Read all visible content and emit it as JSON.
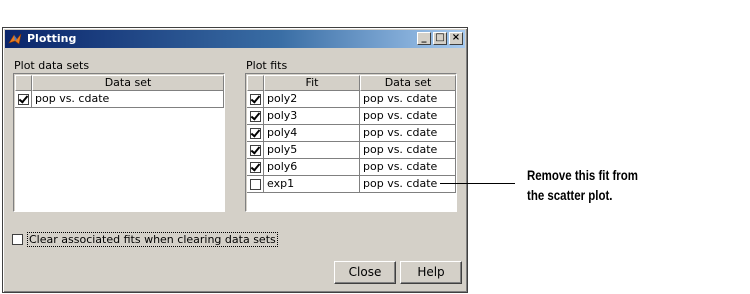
{
  "window": {
    "title": "Plotting",
    "minimize": "_",
    "maximize": "□",
    "close": "×"
  },
  "datasets": {
    "label": "Plot data sets",
    "header": "Data set",
    "rows": [
      {
        "checked": true,
        "name": "pop vs. cdate"
      }
    ]
  },
  "fits": {
    "label": "Plot fits",
    "headers": {
      "fit": "Fit",
      "dataset": "Data set"
    },
    "rows": [
      {
        "checked": true,
        "fit": "poly2",
        "dataset": "pop vs. cdate"
      },
      {
        "checked": true,
        "fit": "poly3",
        "dataset": "pop vs. cdate"
      },
      {
        "checked": true,
        "fit": "poly4",
        "dataset": "pop vs. cdate"
      },
      {
        "checked": true,
        "fit": "poly5",
        "dataset": "pop vs. cdate"
      },
      {
        "checked": true,
        "fit": "poly6",
        "dataset": "pop vs. cdate"
      },
      {
        "checked": false,
        "fit": "exp1",
        "dataset": "pop vs. cdate"
      }
    ]
  },
  "clear_option": {
    "checked": false,
    "label": "Clear associated fits when clearing data sets"
  },
  "buttons": {
    "close": "Close",
    "help": "Help"
  },
  "annotation": {
    "line1": "Remove this fit from",
    "line2": "the scatter plot."
  }
}
